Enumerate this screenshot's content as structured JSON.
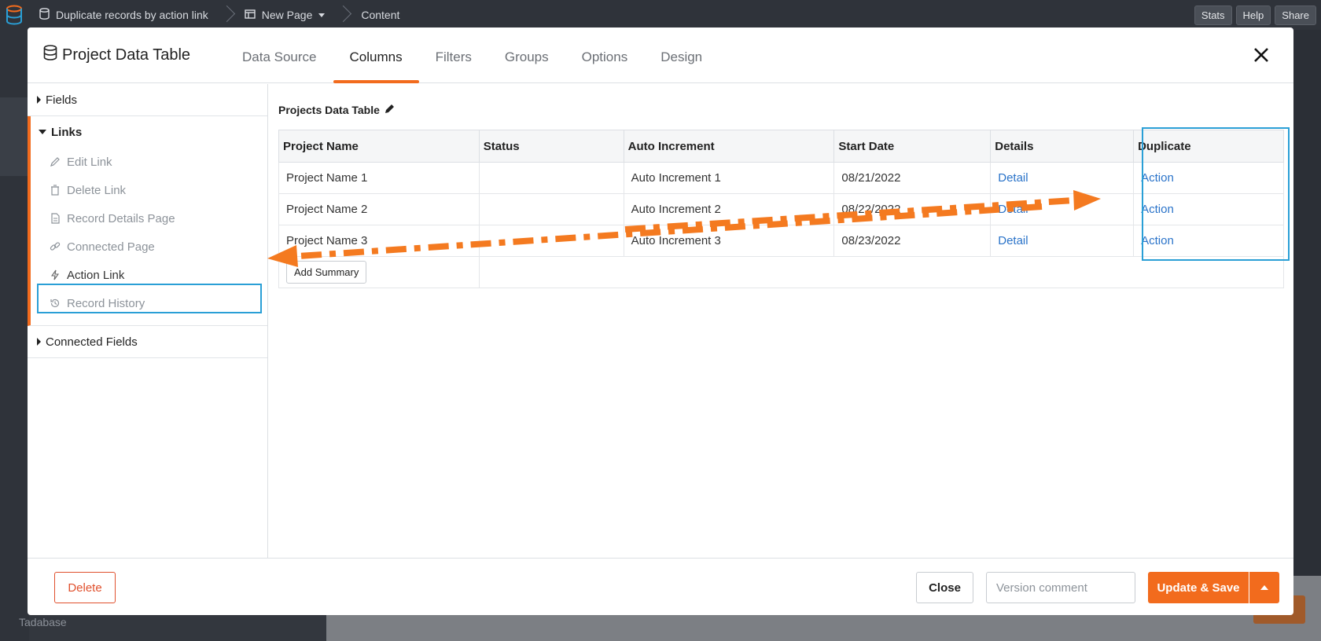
{
  "topbar": {
    "breadcrumbs": [
      "Duplicate records by action link",
      "New Page",
      "Content"
    ],
    "buttons": [
      "Stats",
      "Help",
      "Share"
    ]
  },
  "background": {
    "brand": "Tadabase"
  },
  "modal": {
    "title": "Project Data Table",
    "tabs": [
      "Data Source",
      "Columns",
      "Filters",
      "Groups",
      "Options",
      "Design"
    ],
    "active_tab": "Columns"
  },
  "left_panel": {
    "fields_label": "Fields",
    "links_label": "Links",
    "links": [
      "Edit Link",
      "Delete Link",
      "Record Details Page",
      "Connected Page",
      "Action Link",
      "Record History"
    ],
    "highlighted_link": "Action Link",
    "connected_fields_label": "Connected Fields"
  },
  "main": {
    "table_title": "Projects Data Table",
    "columns": [
      "Project Name",
      "Status",
      "Auto Increment",
      "Start Date",
      "Details",
      "Duplicate"
    ],
    "rows": [
      [
        "Project Name 1",
        "",
        "Auto Increment 1",
        "08/21/2022",
        "Detail",
        "Action"
      ],
      [
        "Project Name 2",
        "",
        "Auto Increment 2",
        "08/22/2022",
        "Detail",
        "Action"
      ],
      [
        "Project Name 3",
        "",
        "Auto Increment 3",
        "08/23/2022",
        "Detail",
        "Action"
      ]
    ],
    "add_summary_label": "Add Summary"
  },
  "footer": {
    "delete_label": "Delete",
    "close_label": "Close",
    "version_placeholder": "Version comment",
    "save_label": "Update & Save"
  },
  "colors": {
    "accent": "#f26b1d",
    "highlight": "#2a9fd6",
    "link": "#2a73c9"
  }
}
